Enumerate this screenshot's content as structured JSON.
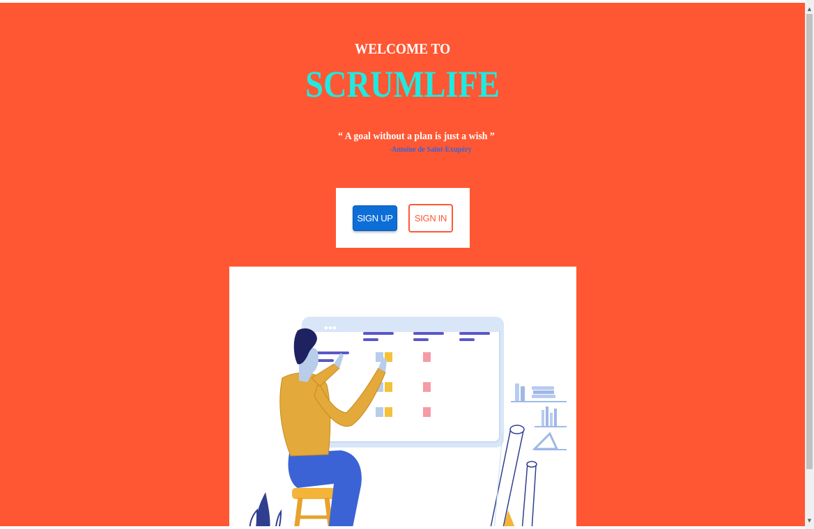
{
  "hero": {
    "welcome": "WELCOME TO",
    "brand": "SCRUMLIFE",
    "quote": "“ A goal without a plan is just a wish ”",
    "author": "-Antoine de Saint-Exupéry"
  },
  "actions": {
    "signup_label": "SIGN UP",
    "signin_label": "SIGN IN"
  },
  "colors": {
    "background": "#ff5733",
    "brand": "#22e8e0",
    "primary_button": "#0d6ed8",
    "author_text": "#3b63d6"
  },
  "illustration": {
    "icon": "person-at-scrum-board-illustration"
  },
  "scrollbar": {
    "up_icon": "▲",
    "down_icon": "▼"
  }
}
